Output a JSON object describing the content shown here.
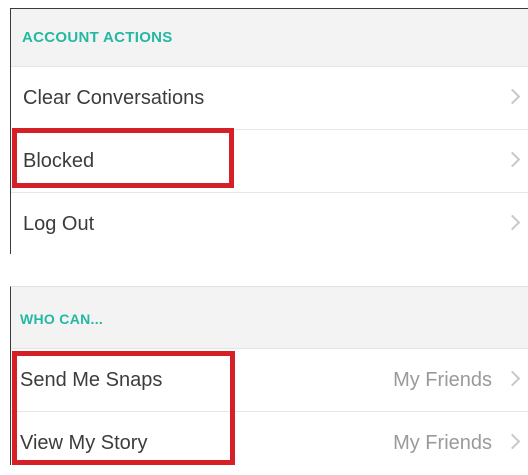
{
  "account_actions": {
    "header": "ACCOUNT ACTIONS",
    "items": [
      {
        "label": "Clear Conversations"
      },
      {
        "label": "Blocked"
      },
      {
        "label": "Log Out"
      }
    ]
  },
  "who_can": {
    "header": "WHO CAN...",
    "items": [
      {
        "label": "Send Me Snaps",
        "value": "My Friends"
      },
      {
        "label": "View My Story",
        "value": "My Friends"
      }
    ]
  },
  "colors": {
    "header_text": "#23b8a2",
    "highlight_box": "#d52027",
    "chevron": "#c8c8c8"
  },
  "icons": [
    "chevron-right-icon"
  ]
}
